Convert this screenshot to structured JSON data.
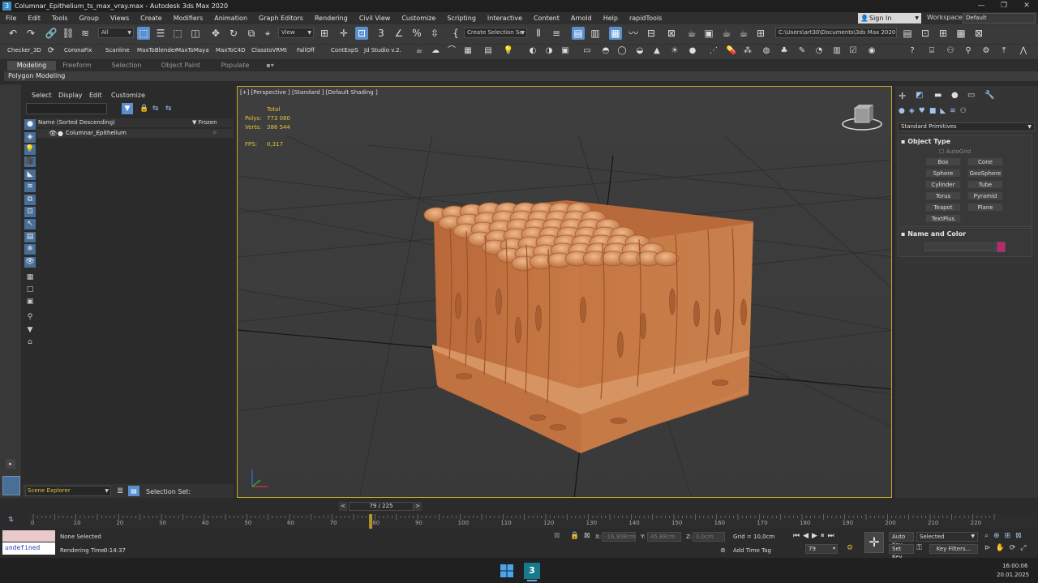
{
  "titlebar": {
    "title": "Columnar_Epithelium_ts_max_vray.max - Autodesk 3ds Max 2020",
    "app_icon": "3"
  },
  "menu": [
    "File",
    "Edit",
    "Tools",
    "Group",
    "Views",
    "Create",
    "Modifiers",
    "Animation",
    "Graph Editors",
    "Rendering",
    "Civil View",
    "Customize",
    "Scripting",
    "Interactive",
    "Content",
    "Arnold",
    "Help",
    "rapidTools"
  ],
  "account": {
    "signin_label": "Sign In",
    "workspace_label": "Workspaces:",
    "workspace_value": "Default"
  },
  "toolbar": {
    "filter_value": "All",
    "refcoord_value": "View",
    "selection_set_placeholder": "Create Selection Se",
    "project_path": "C:\\Users\\art30\\Documents\\3ds Max 2020"
  },
  "plugins": [
    "Checker_3D",
    "CoronaFix",
    "Scanline",
    "MaxToBlender",
    "MaxToMaya",
    "MaxToC4D",
    "ClasstoVRMt",
    "FallOff",
    "ContExpS",
    "Jd Studio v.2."
  ],
  "ribbon": {
    "tabs": [
      "Modeling",
      "Freeform",
      "Selection",
      "Object Paint",
      "Populate"
    ],
    "active": "Modeling",
    "panel": "Polygon Modeling"
  },
  "scene_explorer": {
    "menu": [
      "Select",
      "Display",
      "Edit",
      "Customize"
    ],
    "column_name": "Name (Sorted Descending)",
    "column_frozen": "Frozen",
    "objects": [
      "Columnar_Epithelium"
    ],
    "explorer_name": "Scene Explorer",
    "selection_set_label": "Selection Set:"
  },
  "viewport": {
    "label": "[+] [Perspective ] [Standard ] [Default Shading ]",
    "stats": {
      "total_label": "Total",
      "polys_label": "Polys:",
      "polys_value": "773 080",
      "verts_label": "Verts:",
      "verts_value": "386 544",
      "fps_label": "FPS:",
      "fps_value": "0,317"
    }
  },
  "command_panel": {
    "category": "Standard Primitives",
    "object_type_title": "Object Type",
    "autogrid": "AutoGrid",
    "buttons": [
      "Box",
      "Cone",
      "Sphere",
      "GeoSphere",
      "Cylinder",
      "Tube",
      "Torus",
      "Pyramid",
      "Teapot",
      "Plane",
      "TextPlus"
    ],
    "name_color_title": "Name and Color",
    "object_color": "#c2246e"
  },
  "timeline": {
    "frame_display": "79 / 225",
    "current_frame": 79,
    "total_frames": 225,
    "ticks": [
      "0",
      "10",
      "20",
      "30",
      "40",
      "50",
      "60",
      "70",
      "80",
      "90",
      "100",
      "110",
      "120",
      "130",
      "140",
      "150",
      "160",
      "170",
      "180",
      "190",
      "200",
      "210",
      "220"
    ]
  },
  "status": {
    "maxscript_value": "undefined",
    "selection_text": "None Selected",
    "render_time_label": "Rendering Time",
    "render_time_value": "0:14:37",
    "x_label": "X:",
    "x_value": "-16,908cm",
    "y_label": "Y:",
    "y_value": "45,88cm",
    "z_label": "Z:",
    "z_value": "0,0cm",
    "grid": "Grid = 10,0cm",
    "add_time_tag": "Add Time Tag",
    "autokey": "Auto Key",
    "autokey_mode": "Selected",
    "setkey": "Set Key",
    "key_filters": "Key Filters...",
    "frame_field": "79"
  },
  "taskbar": {
    "time": "16:00:06",
    "date": "20.01.2025"
  }
}
